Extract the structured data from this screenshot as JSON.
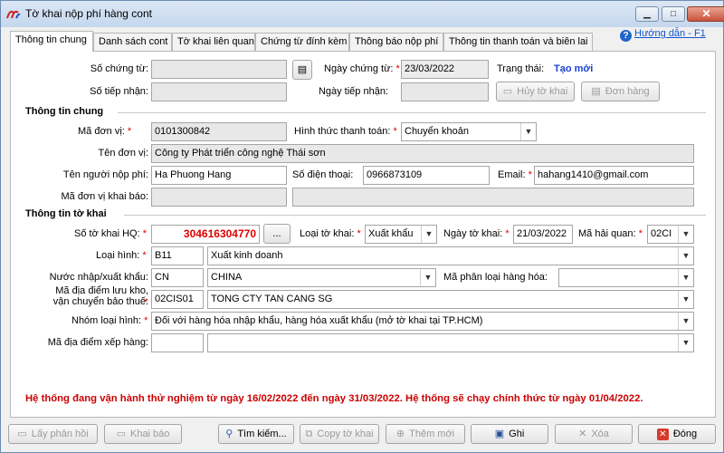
{
  "window": {
    "title": "Tờ khai nộp phí hàng cont",
    "min": "▁",
    "max": "□",
    "close": "✕"
  },
  "tabs": [
    "Thông tin chung",
    "Danh sách cont",
    "Tờ khai liên quan",
    "Chứng từ đính kèm",
    "Thông báo nộp phí",
    "Thông tin thanh toán và biên lai"
  ],
  "help": {
    "icon": "?",
    "label": "Hướng dẫn - F1"
  },
  "form": {
    "so_chung_tu": {
      "label": "Số chứng từ:",
      "value": ""
    },
    "so_tiep_nhan": {
      "label": "Số tiếp nhận:",
      "value": ""
    },
    "ngay_chung_tu": {
      "label": "Ngày chứng từ:",
      "value": "23/03/2022"
    },
    "ngay_tiep_nhan": {
      "label": "Ngày tiếp nhận:",
      "value": ""
    },
    "trang_thai": {
      "label": "Trạng thái:",
      "value": "Tạo mới"
    },
    "btn_huy": "Hủy tờ khai",
    "btn_don_hang": "Đơn hàng",
    "section_chung": "Thông tin chung",
    "ma_don_vi": {
      "label": "Mã đơn vị:",
      "value": "0101300842"
    },
    "hinh_thuc": {
      "label": "Hình thức thanh toán:",
      "value": "Chuyển khoản"
    },
    "ten_don_vi": {
      "label": "Tên đơn vị:",
      "value": "Công ty Phát triển công nghệ Thái sơn"
    },
    "ten_nguoi_nop": {
      "label": "Tên người nộp phí:",
      "value": "Ha Phuong Hang"
    },
    "so_dien_thoai": {
      "label": "Số điện thoại:",
      "value": "0966873109"
    },
    "email": {
      "label": "Email:",
      "value": "hahang1410@gmail.com"
    },
    "ma_don_vi_kb": {
      "label": "Mã đơn vị khai báo:",
      "value": ""
    },
    "section_tk": "Thông tin tờ khai",
    "so_to_khai": {
      "label": "Số tờ khai HQ:",
      "value": "304616304770",
      "btn": "..."
    },
    "loai_to_khai": {
      "label": "Loại tờ khai:",
      "value": "Xuất khẩu"
    },
    "ngay_to_khai": {
      "label": "Ngày tờ khai:",
      "value": "21/03/2022"
    },
    "ma_hai_quan": {
      "label": "Mã hải quan:",
      "value": "02CI"
    },
    "loai_hinh": {
      "label": "Loại hình:",
      "code": "B11",
      "value": "Xuất kinh doanh"
    },
    "nuoc": {
      "label": "Nước nhập/xuất khẩu:",
      "code": "CN",
      "value": "CHINA"
    },
    "ma_phan_loai": {
      "label": "Mã phân loại hàng hóa:",
      "value": ""
    },
    "ma_dia_diem_lk": {
      "label1": "Mã địa điểm lưu kho,",
      "label2": "vận chuyển bảo thuế:",
      "code": "02CIS01",
      "value": "TONG CTY TAN CANG SG"
    },
    "nhom_loai_hinh": {
      "label": "Nhóm loại hình:",
      "value": "Đối với hàng hóa nhập khẩu, hàng hóa xuất khẩu (mở tờ khai tại TP.HCM)"
    },
    "ma_dia_diem_xh": {
      "label": "Mã địa điểm xếp hàng:",
      "code": "",
      "value": ""
    }
  },
  "notice": "Hệ thống đang vận hành thử nghiệm từ ngày 16/02/2022 đến ngày 31/03/2022. Hệ thống sẽ chạy chính thức từ ngày 01/04/2022.",
  "buttons": {
    "lay_phan_hoi": "Lấy phản hồi",
    "khai_bao": "Khai báo",
    "tim_kiem": "Tìm kiếm...",
    "copy": "Copy tờ khai",
    "them_moi": "Thêm mới",
    "ghi": "Ghi",
    "xoa": "Xóa",
    "dong": "Đóng"
  },
  "colors": {
    "status": "#1a3fd6",
    "notice": "#cc0000",
    "required": "#e00000"
  }
}
